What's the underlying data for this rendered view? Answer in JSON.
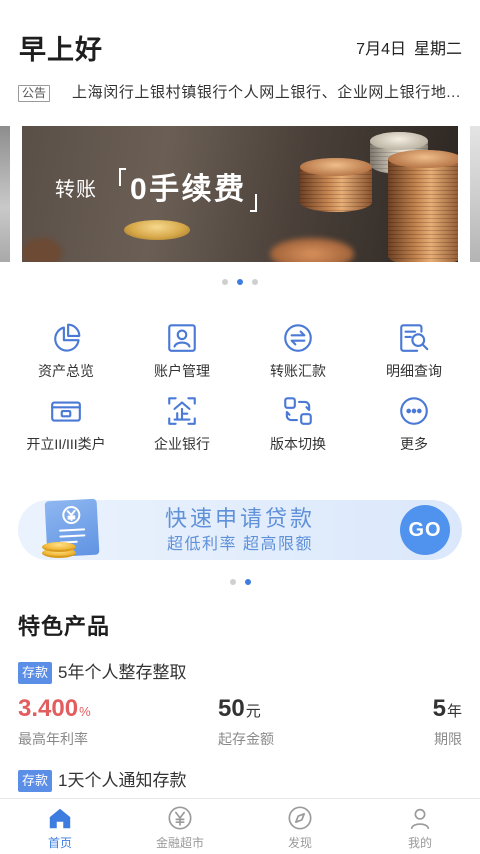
{
  "header": {
    "greeting": "早上好",
    "date": "7月4日",
    "weekday": "星期二"
  },
  "notice": {
    "badge": "公告",
    "text": "上海闵行上银村镇银行个人网上银行、企业网上银行地..."
  },
  "banner": {
    "prefix": "转账",
    "highlight": "0手续费",
    "indicator": {
      "count": 3,
      "active": 2
    }
  },
  "quick_menu": [
    {
      "label": "资产总览",
      "icon": "pie-chart-icon"
    },
    {
      "label": "账户管理",
      "icon": "account-card-icon"
    },
    {
      "label": "转账汇款",
      "icon": "transfer-icon"
    },
    {
      "label": "明细查询",
      "icon": "statement-search-icon"
    },
    {
      "label": "开立II/III类户",
      "icon": "bank-card-icon"
    },
    {
      "label": "企业银行",
      "icon": "enterprise-icon"
    },
    {
      "label": "版本切换",
      "icon": "switch-version-icon"
    },
    {
      "label": "更多",
      "icon": "more-icon"
    }
  ],
  "loan_banner": {
    "title": "快速申请贷款",
    "subtitle": "超低利率 超高限额",
    "button": "GO",
    "indicator": {
      "count": 2,
      "active": 2
    }
  },
  "featured": {
    "title": "特色产品",
    "products": [
      {
        "badge": "存款",
        "name": "5年个人整存整取",
        "rate": "3.400",
        "rate_unit": "%",
        "rate_label": "最高年利率",
        "min_amount": "50",
        "min_unit": "元",
        "min_label": "起存金额",
        "term": "5",
        "term_unit": "年",
        "term_label": "期限"
      },
      {
        "badge": "存款",
        "name": "1天个人通知存款"
      }
    ]
  },
  "tabbar": [
    {
      "label": "首页",
      "icon": "home-icon",
      "active": true
    },
    {
      "label": "金融超市",
      "icon": "finance-market-icon",
      "active": false
    },
    {
      "label": "发现",
      "icon": "compass-icon",
      "active": false
    },
    {
      "label": "我的",
      "icon": "profile-icon",
      "active": false
    }
  ],
  "colors": {
    "accent": "#3d7de0",
    "icon": "#4a79d6",
    "rate": "#e35d5f",
    "badge": "#5b8ee6",
    "loan_text": "#5f91d9",
    "go_button": "#4f93ee",
    "tab_inactive": "#9a9a9a"
  }
}
